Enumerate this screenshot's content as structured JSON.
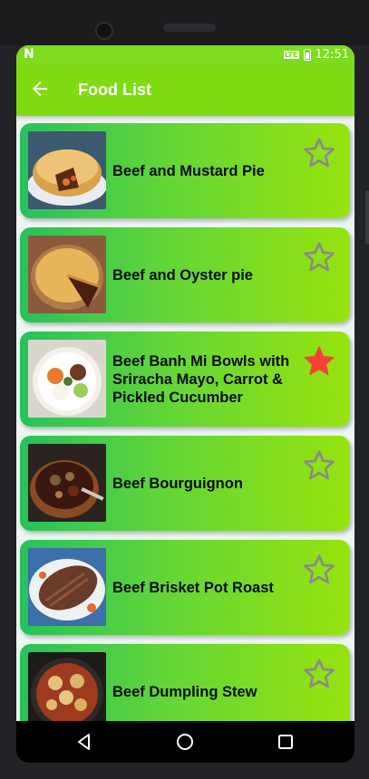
{
  "status_bar": {
    "notification_icon": "N",
    "network": "LTE",
    "time": "12:51"
  },
  "app_bar": {
    "back_icon": "arrow-back-icon",
    "title": "Food List"
  },
  "foods": [
    {
      "name": "Beef and Mustard Pie",
      "favorite": false,
      "image": "pie-image"
    },
    {
      "name": "Beef and Oyster pie",
      "favorite": false,
      "image": "pie-image"
    },
    {
      "name": "Beef Banh Mi Bowls with Sriracha Mayo, Carrot & Pickled Cucumber",
      "favorite": true,
      "image": "bowl-image"
    },
    {
      "name": "Beef Bourguignon",
      "favorite": false,
      "image": "stew-image"
    },
    {
      "name": "Beef Brisket Pot Roast",
      "favorite": false,
      "image": "roast-image"
    },
    {
      "name": "Beef Dumpling Stew",
      "favorite": false,
      "image": "stew-image"
    }
  ],
  "colors": {
    "app_bar": "#7fdc12",
    "card_gradient_start": "#27c15c",
    "card_gradient_end": "#97e30d",
    "star_empty": "#8a8a8a",
    "star_filled": "#f44336"
  },
  "nav_bar": {
    "back_icon": "triangle-back-icon",
    "home_icon": "circle-home-icon",
    "recents_icon": "square-recents-icon"
  }
}
